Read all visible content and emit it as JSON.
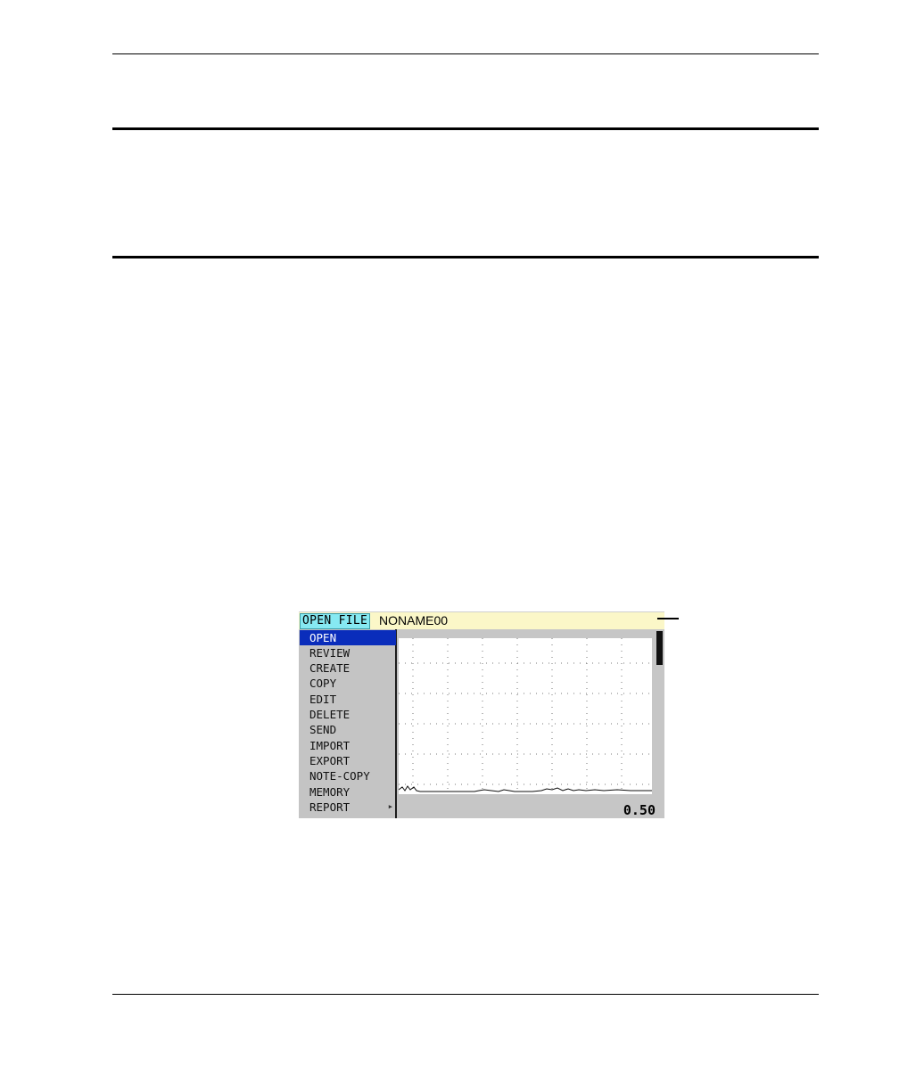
{
  "screen": {
    "title_label": "OPEN FILE",
    "title_value": "NONAME00",
    "menu_items": [
      {
        "label": "OPEN",
        "selected": true
      },
      {
        "label": "REVIEW"
      },
      {
        "label": "CREATE"
      },
      {
        "label": "COPY"
      },
      {
        "label": "EDIT"
      },
      {
        "label": "DELETE"
      },
      {
        "label": "SEND"
      },
      {
        "label": "IMPORT"
      },
      {
        "label": "EXPORT"
      },
      {
        "label": "NOTE-COPY"
      },
      {
        "label": "MEMORY"
      },
      {
        "label": "REPORT",
        "has_submenu": true
      }
    ],
    "readout": "0.50"
  },
  "colors": {
    "title_label_bg": "#86e9f2",
    "title_bar_bg": "#fbf7c8",
    "menu_bg": "#c4c4c4",
    "selected_bg": "#0a2dbb"
  }
}
